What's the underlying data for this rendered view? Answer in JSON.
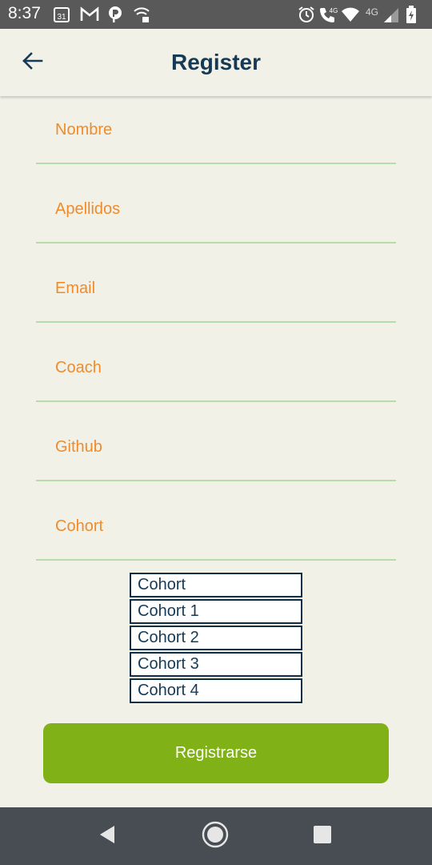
{
  "status_bar": {
    "time": "8:37",
    "icons": [
      "calendar-icon",
      "gmail-icon",
      "parking-icon",
      "wifi-calling-icon",
      "alarm-icon",
      "volte-call-icon",
      "wifi-icon",
      "signal-4g-icon",
      "battery-icon"
    ],
    "calendar_day": "31",
    "lte_label": "4G",
    "network_label": "4G"
  },
  "header": {
    "title": "Register",
    "back_icon": "arrow-left-icon"
  },
  "form": {
    "fields": [
      {
        "label": "Nombre"
      },
      {
        "label": "Apellidos"
      },
      {
        "label": "Email"
      },
      {
        "label": "Coach"
      },
      {
        "label": "Github"
      },
      {
        "label": "Cohort"
      }
    ],
    "cohort_options": [
      "Cohort",
      "Cohort 1",
      "Cohort 2",
      "Cohort 3",
      "Cohort 4"
    ]
  },
  "submit_label": "Registrarse",
  "nav_bar": {
    "buttons": [
      "back-triangle-icon",
      "home-circle-icon",
      "recents-square-icon"
    ]
  },
  "colors": {
    "background": "#f2f1e8",
    "title": "#163a56",
    "field_label": "#ee8c2c",
    "field_underline": "#b6dcab",
    "button": "#80b217",
    "status_bar": "#595959",
    "nav_bar": "#474d53"
  }
}
